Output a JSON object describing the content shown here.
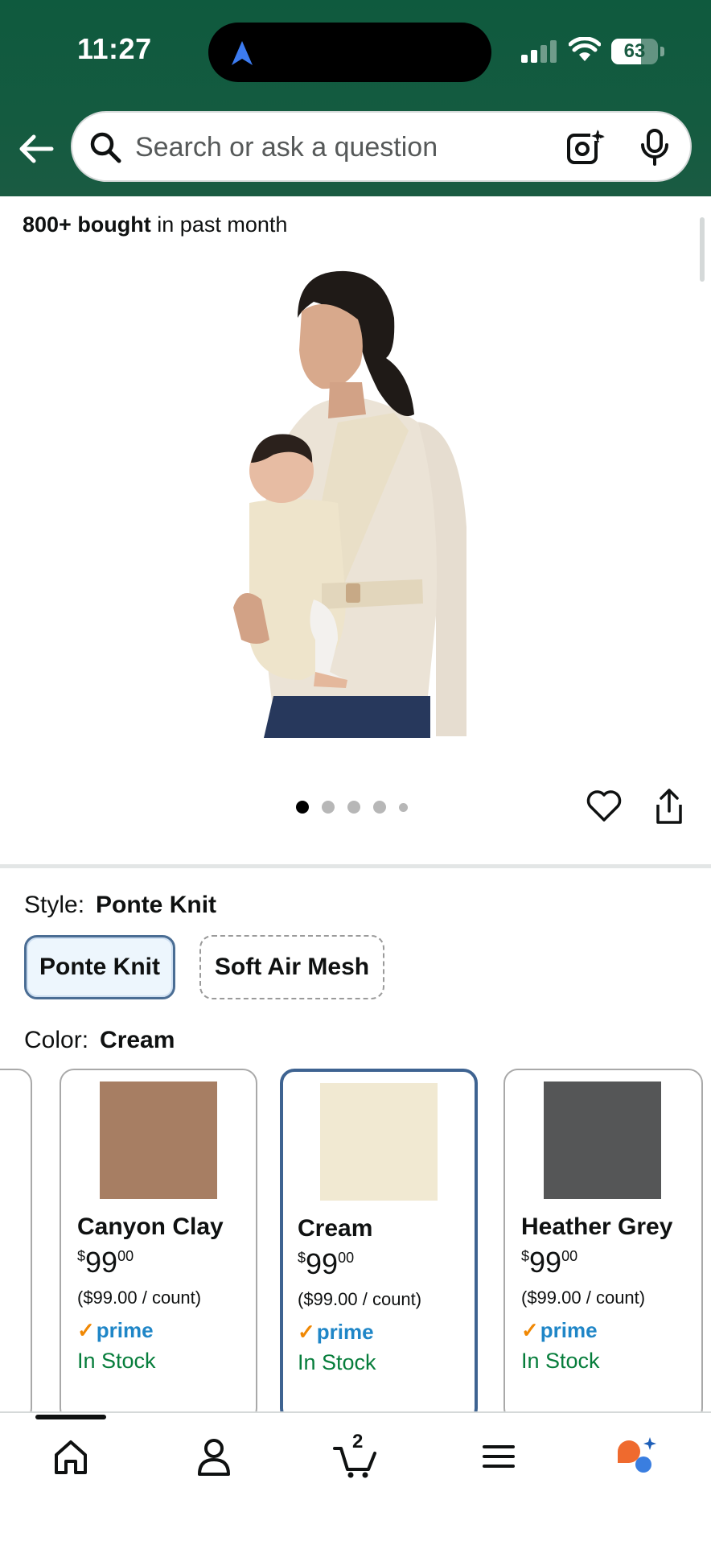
{
  "status_bar": {
    "time": "11:27",
    "battery_level": 63,
    "battery_text": "63"
  },
  "header": {
    "search_placeholder": "Search or ask a question"
  },
  "product": {
    "bought_bold": "800+ bought",
    "bought_rest": " in past month",
    "image_count": 5,
    "active_image_index": 0
  },
  "style": {
    "label": "Style:",
    "selected": "Ponte Knit",
    "options": [
      "Ponte Knit",
      "Soft Air Mesh"
    ]
  },
  "color": {
    "label": "Color:",
    "selected": "Cream",
    "cards": [
      {
        "name": "Canyon Clay",
        "swatch": "#a77e63",
        "price_symbol": "$",
        "price_whole": "99",
        "price_cents": "00",
        "unit_price": "($99.00 / count)",
        "prime": "prime",
        "stock": "In Stock"
      },
      {
        "name": "Cream",
        "swatch": "#f1e9d2",
        "price_symbol": "$",
        "price_whole": "99",
        "price_cents": "00",
        "unit_price": "($99.00 / count)",
        "prime": "prime",
        "stock": "In Stock"
      },
      {
        "name": "Heather Grey",
        "swatch": "#555657",
        "price_symbol": "$",
        "price_whole": "99",
        "price_cents": "00",
        "unit_price": "($99.00 / count)",
        "prime": "prime",
        "stock": "In Stock"
      }
    ]
  },
  "tabbar": {
    "items": [
      "home-icon",
      "account-icon",
      "cart-icon",
      "menu-icon",
      "rufus-icon"
    ],
    "cart_count": "2"
  },
  "colors": {
    "header_green": "#145b40",
    "prime_blue": "#1f86c7",
    "stock_green": "#067d3b",
    "selected_border": "#3e6391"
  }
}
